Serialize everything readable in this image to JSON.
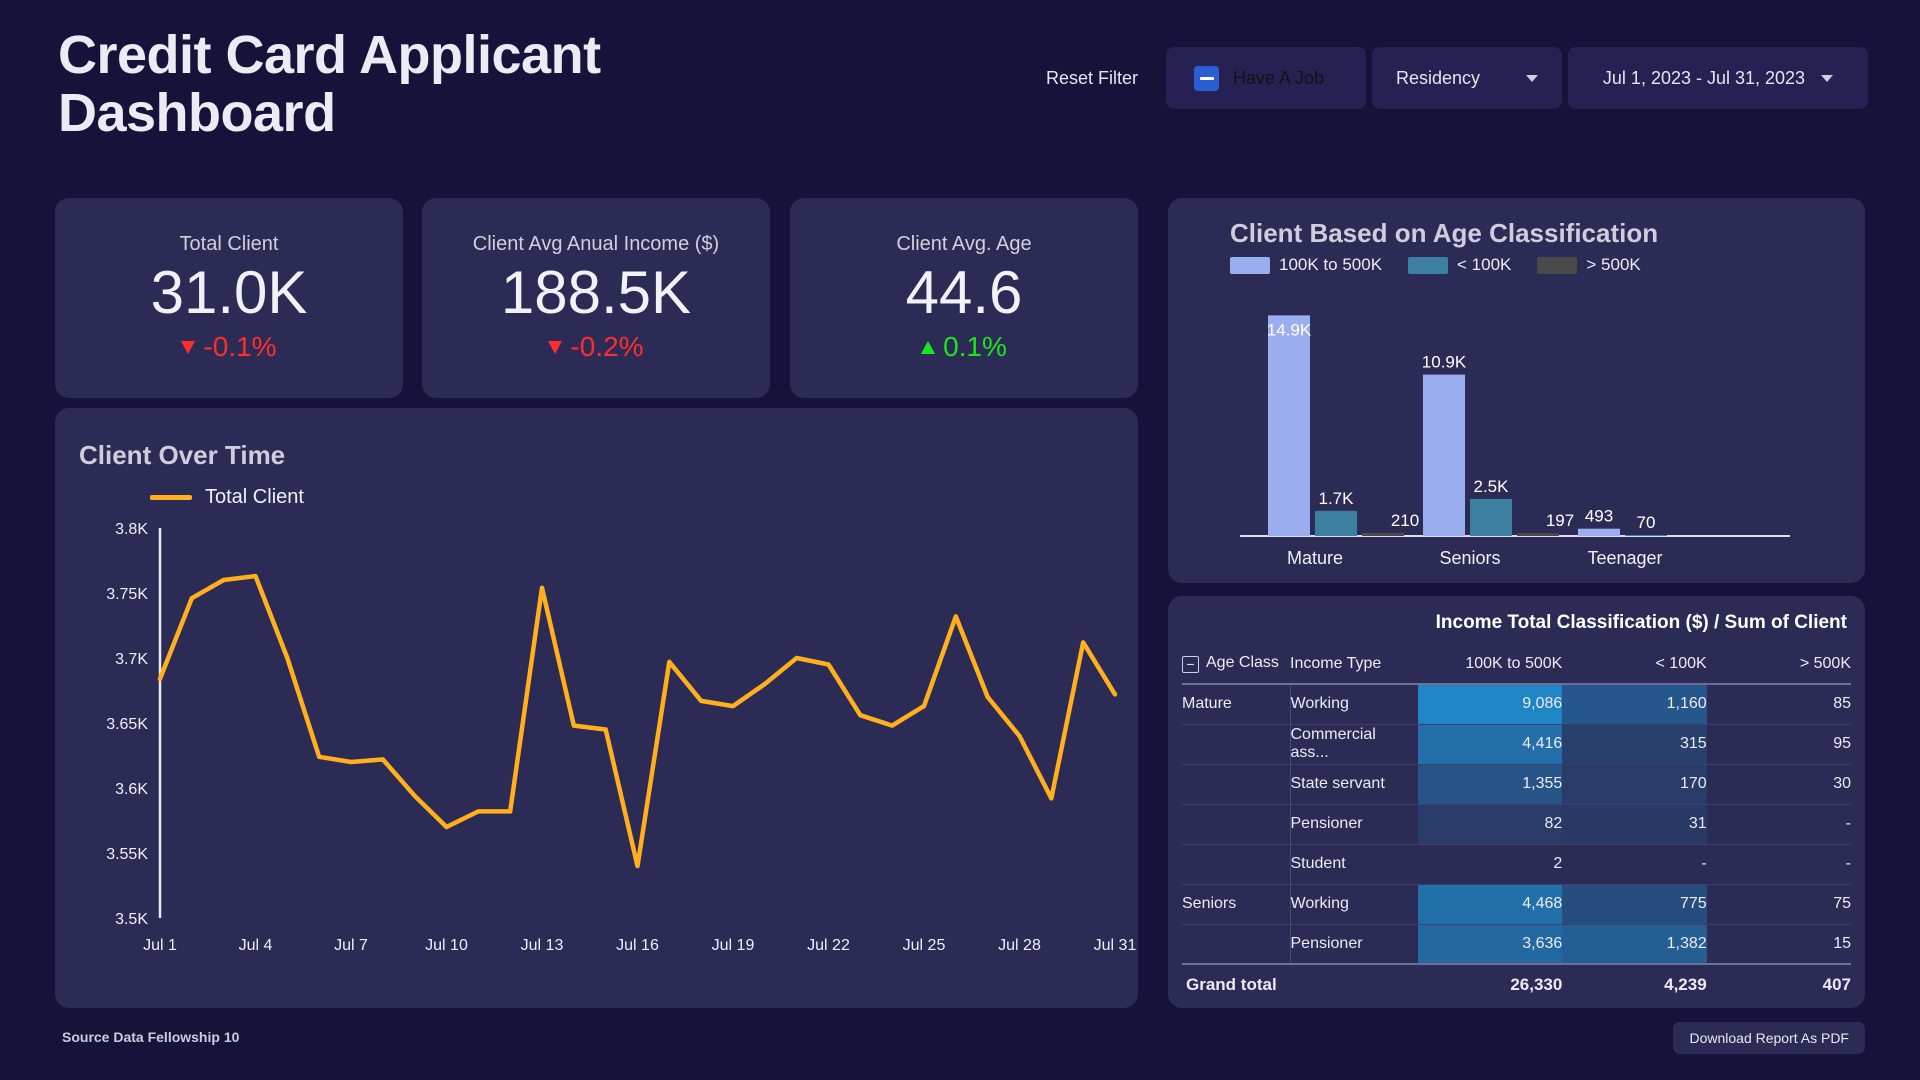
{
  "header": {
    "title": "Credit Card Applicant Dashboard",
    "reset_filter": "Reset Filter",
    "have_a_job": "Have A Job",
    "residency": "Residency",
    "date_range": "Jul 1, 2023 - Jul 31, 2023"
  },
  "kpis": [
    {
      "title": "Total Client",
      "value": "31.0K",
      "delta": "-0.1%",
      "direction": "down"
    },
    {
      "title": "Client Avg Anual Income ($)",
      "value": "188.5K",
      "delta": "-0.2%",
      "direction": "down"
    },
    {
      "title": "Client Avg. Age",
      "value": "44.6",
      "delta": "0.1%",
      "direction": "up"
    }
  ],
  "line_panel": {
    "title": "Client Over Time",
    "legend": "Total Client"
  },
  "bar_panel": {
    "title": "Client Based on Age Classification",
    "legend": [
      {
        "label": "100K to 500K",
        "color": "#9aaef0"
      },
      {
        "label": "< 100K",
        "color": "#3d7fa0"
      },
      {
        "label": "> 500K",
        "color": "#4a4a4a"
      }
    ]
  },
  "table_panel": {
    "caption": "Income Total Classification ($) / Sum of Client",
    "expander": "−",
    "columns": [
      "Age Class",
      "Income Type",
      "100K to 500K",
      "< 100K",
      "> 500K"
    ],
    "rows": [
      {
        "age": "Mature",
        "income": "Working",
        "v1": "9,086",
        "v2": "1,160",
        "v3": "85",
        "h1": 1.0,
        "h2": 0.42,
        "h3": 0.0
      },
      {
        "age": "",
        "income": "Commercial ass...",
        "v1": "4,416",
        "v2": "315",
        "v3": "95",
        "h1": 0.72,
        "h2": 0.12,
        "h3": 0.0
      },
      {
        "age": "",
        "income": "State servant",
        "v1": "1,355",
        "v2": "170",
        "v3": "30",
        "h1": 0.38,
        "h2": 0.06,
        "h3": 0.0
      },
      {
        "age": "",
        "income": "Pensioner",
        "v1": "82",
        "v2": "31",
        "v3": "-",
        "h1": 0.05,
        "h2": 0.02,
        "h3": 0.0
      },
      {
        "age": "",
        "income": "Student",
        "v1": "2",
        "v2": "-",
        "v3": "-",
        "h1": 0.0,
        "h2": 0.0,
        "h3": 0.0
      },
      {
        "age": "Seniors",
        "income": "Working",
        "v1": "4,468",
        "v2": "775",
        "v3": "75",
        "h1": 0.73,
        "h2": 0.28,
        "h3": 0.0
      },
      {
        "age": "",
        "income": "Pensioner",
        "v1": "3,636",
        "v2": "1,382",
        "v3": "15",
        "h1": 0.64,
        "h2": 0.5,
        "h3": 0.0
      }
    ],
    "total": {
      "label": "Grand total",
      "v1": "26,330",
      "v2": "4,239",
      "v3": "407"
    }
  },
  "footer": {
    "source": "Source Data Fellowship 10",
    "download": "Download Report As PDF"
  },
  "colors": {
    "background": "#17123a",
    "panel": "#2c2b55",
    "accent_line": "#ffb01c",
    "bar_primary": "#9aaef0",
    "bar_secondary": "#3d7fa0",
    "bar_tertiary": "#4a4a4a",
    "positive": "#19e61e",
    "negative": "#ff2d2d",
    "heat": "#1f8fd0"
  },
  "chart_data": [
    {
      "type": "line",
      "title": "Client Over Time",
      "xlabel": "",
      "ylabel": "",
      "ylim": [
        3500,
        3800
      ],
      "yticks": [
        "3.5K",
        "3.55K",
        "3.6K",
        "3.65K",
        "3.7K",
        "3.75K",
        "3.8K"
      ],
      "xticks": [
        "Jul 1",
        "Jul 4",
        "Jul 7",
        "Jul 10",
        "Jul 13",
        "Jul 16",
        "Jul 19",
        "Jul 22",
        "Jul 25",
        "Jul 28",
        "Jul 31"
      ],
      "grid": false,
      "legend": [
        "Total Client"
      ],
      "legend_position": "top-left",
      "series": [
        {
          "name": "Total Client",
          "color": "#ffb01c",
          "x": [
            "Jul 1",
            "Jul 2",
            "Jul 3",
            "Jul 4",
            "Jul 5",
            "Jul 6",
            "Jul 7",
            "Jul 8",
            "Jul 9",
            "Jul 10",
            "Jul 11",
            "Jul 12",
            "Jul 13",
            "Jul 14",
            "Jul 15",
            "Jul 16",
            "Jul 17",
            "Jul 18",
            "Jul 19",
            "Jul 20",
            "Jul 21",
            "Jul 22",
            "Jul 23",
            "Jul 24",
            "Jul 25",
            "Jul 26",
            "Jul 27",
            "Jul 28",
            "Jul 29",
            "Jul 30",
            "Jul 31"
          ],
          "values": [
            3684,
            3746,
            3760,
            3763,
            3700,
            3624,
            3620,
            3622,
            3594,
            3570,
            3582,
            3582,
            3754,
            3648,
            3645,
            3540,
            3697,
            3667,
            3663,
            3680,
            3700,
            3695,
            3656,
            3648,
            3663,
            3732,
            3670,
            3640,
            3592,
            3712,
            3672
          ]
        }
      ]
    },
    {
      "type": "bar",
      "title": "Client Based on Age Classification",
      "categories": [
        "Mature",
        "Seniors",
        "Teenager"
      ],
      "xlabel": "",
      "ylabel": "",
      "grid": false,
      "legend_position": "top-left",
      "series": [
        {
          "name": "100K to 500K",
          "color": "#9aaef0",
          "values": [
            14900,
            10900,
            493
          ],
          "labels": [
            "14.9K",
            "10.9K",
            "493"
          ]
        },
        {
          "name": "< 100K",
          "color": "#3d7fa0",
          "values": [
            1700,
            2500,
            70
          ],
          "labels": [
            "1.7K",
            "2.5K",
            "70"
          ]
        },
        {
          "name": "> 500K",
          "color": "#4a4a4a",
          "values": [
            210,
            197,
            0
          ],
          "labels": [
            "210",
            "197",
            ""
          ]
        }
      ]
    },
    {
      "type": "table",
      "title": "Income Total Classification ($) / Sum of Client",
      "columns": [
        "Age Class",
        "Income Type",
        "100K to 500K",
        "< 100K",
        "> 500K"
      ],
      "rows": [
        [
          "Mature",
          "Working",
          9086,
          1160,
          85
        ],
        [
          "Mature",
          "Commercial ass...",
          4416,
          315,
          95
        ],
        [
          "Mature",
          "State servant",
          1355,
          170,
          30
        ],
        [
          "Mature",
          "Pensioner",
          82,
          31,
          null
        ],
        [
          "Mature",
          "Student",
          2,
          null,
          null
        ],
        [
          "Seniors",
          "Working",
          4468,
          775,
          75
        ],
        [
          "Seniors",
          "Pensioner",
          3636,
          1382,
          15
        ]
      ],
      "totals": [
        "Grand total",
        "",
        26330,
        4239,
        407
      ]
    }
  ]
}
